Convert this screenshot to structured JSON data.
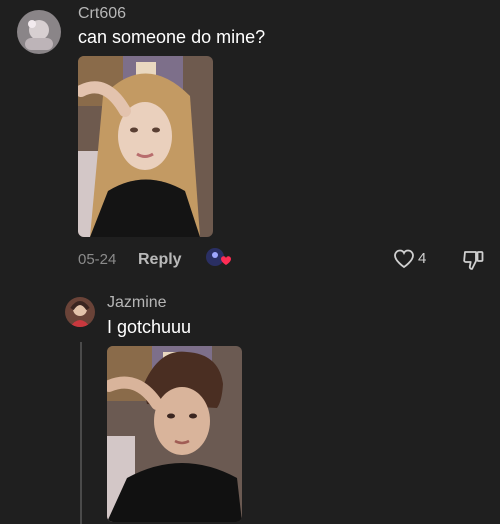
{
  "comment": {
    "username": "Crt606",
    "text": "can someone do mine?",
    "date": "05-24",
    "reply_label": "Reply",
    "like_count": "4",
    "avatar_icon": "user-avatar",
    "photo_icon": "selfie-photo"
  },
  "reply": {
    "username": "Jazmine",
    "text": "I gotchuuu",
    "avatar_icon": "user-avatar",
    "photo_icon": "edited-selfie-photo"
  },
  "icons": {
    "reaction": "creator-liked-icon",
    "like": "heart-outline-icon",
    "dislike": "thumbs-down-icon"
  },
  "colors": {
    "background": "#1f1f1f",
    "username": "#b6b6b6",
    "meta": "#8b8b8b",
    "heart_accent": "#ff2d55"
  }
}
